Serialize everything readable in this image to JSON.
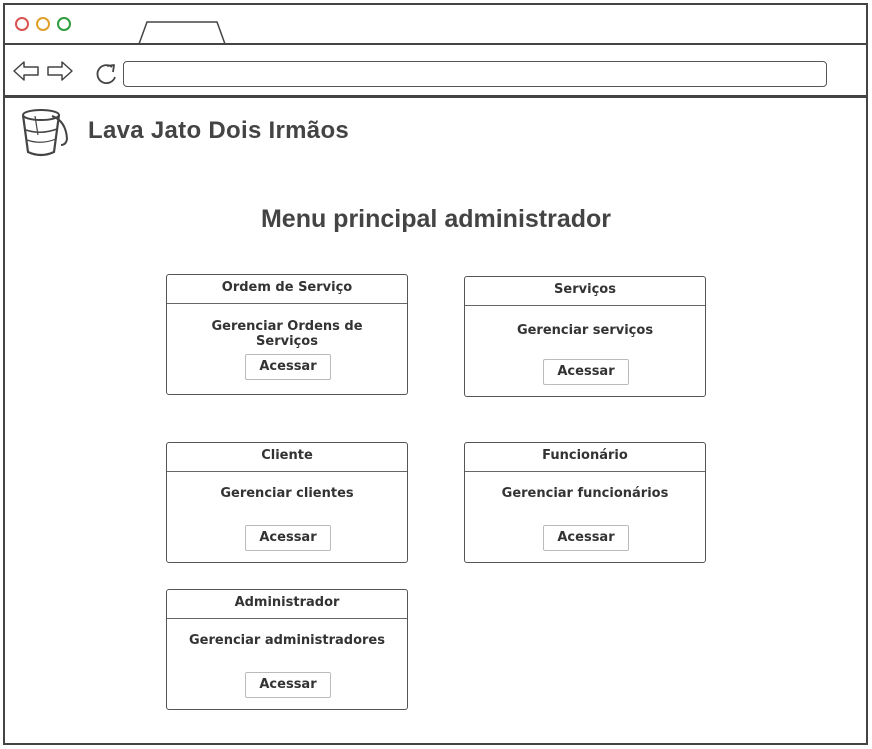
{
  "browser": {
    "buttons": {
      "close": "#d9534f",
      "minimize": "#e0a02a",
      "maximize": "#2e9c3a"
    },
    "address_value": ""
  },
  "header": {
    "logo_icon": "bucket-icon",
    "app_title": "Lava Jato Dois Irmãos"
  },
  "main": {
    "heading": "Menu principal administrador",
    "cards": [
      {
        "title": "Ordem de Serviço",
        "description": "Gerenciar Ordens de Serviços",
        "button": "Acessar"
      },
      {
        "title": "Serviços",
        "description": "Gerenciar serviços",
        "button": "Acessar"
      },
      {
        "title": "Cliente",
        "description": "Gerenciar clientes",
        "button": "Acessar"
      },
      {
        "title": "Funcionário",
        "description": "Gerenciar funcionários",
        "button": "Acessar"
      },
      {
        "title": "Administrador",
        "description": "Gerenciar administradores",
        "button": "Acessar"
      }
    ]
  }
}
